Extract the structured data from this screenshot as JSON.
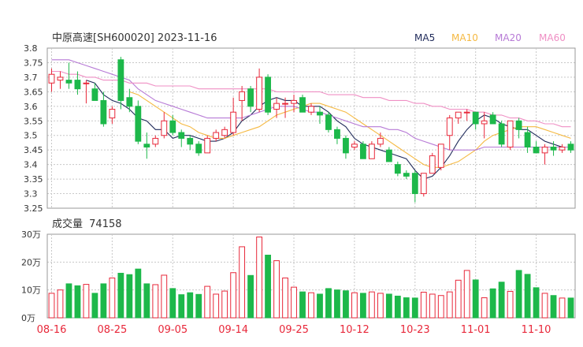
{
  "header": {
    "title": "中原高速[SH600020] 2023-11-16",
    "ma_labels": [
      {
        "label": "MA5",
        "color": "#1f2a5a"
      },
      {
        "label": "MA10",
        "color": "#f5b942"
      },
      {
        "label": "MA20",
        "color": "#b77ad6"
      },
      {
        "label": "MA60",
        "color": "#ef8fc4"
      }
    ]
  },
  "volume_header": {
    "label": "成交量",
    "value": "74158"
  },
  "colors": {
    "up": "#e8283a",
    "down": "#1db84a",
    "grid": "#c8c8c8",
    "axis": "#333333",
    "date": "#e8283a"
  },
  "chart_data": [
    {
      "type": "candlestick",
      "title": "中原高速[SH600020] 2023-11-16",
      "y_ticks": [
        "3.8",
        "3.75",
        "3.7",
        "3.65",
        "3.6",
        "3.55",
        "3.5",
        "3.45",
        "3.4",
        "3.35",
        "3.3",
        "3.25"
      ],
      "ylim": [
        3.25,
        3.8
      ],
      "dates": [
        "08-16",
        "08-17",
        "08-18",
        "08-21",
        "08-22",
        "08-23",
        "08-24",
        "08-25",
        "08-28",
        "08-29",
        "08-30",
        "08-31",
        "09-01",
        "09-04",
        "09-05",
        "09-06",
        "09-07",
        "09-08",
        "09-11",
        "09-12",
        "09-13",
        "09-14",
        "09-15",
        "09-18",
        "09-19",
        "09-20",
        "09-21",
        "09-22",
        "09-25",
        "09-26",
        "09-27",
        "09-28",
        "10-09",
        "10-10",
        "10-11",
        "10-12",
        "10-13",
        "10-16",
        "10-17",
        "10-18",
        "10-19",
        "10-20",
        "10-23",
        "10-24",
        "10-25",
        "10-26",
        "10-27",
        "10-30",
        "10-31",
        "11-01",
        "11-02",
        "11-03",
        "11-06",
        "11-07",
        "11-08",
        "11-09",
        "11-10",
        "11-13",
        "11-14",
        "11-15",
        "11-16"
      ],
      "x_tick_labels": [
        "08-16",
        "08-25",
        "09-05",
        "09-14",
        "09-25",
        "10-12",
        "10-23",
        "11-01",
        "11-10"
      ],
      "x_tick_index": [
        0,
        7,
        14,
        21,
        28,
        35,
        42,
        49,
        56
      ],
      "ohlc": [
        [
          3.68,
          3.73,
          3.65,
          3.71
        ],
        [
          3.69,
          3.72,
          3.66,
          3.7
        ],
        [
          3.69,
          3.75,
          3.66,
          3.68
        ],
        [
          3.69,
          3.72,
          3.64,
          3.66
        ],
        [
          3.68,
          3.69,
          3.61,
          3.68
        ],
        [
          3.66,
          3.68,
          3.62,
          3.62
        ],
        [
          3.62,
          3.65,
          3.53,
          3.54
        ],
        [
          3.56,
          3.6,
          3.54,
          3.59
        ],
        [
          3.76,
          3.77,
          3.59,
          3.62
        ],
        [
          3.63,
          3.66,
          3.58,
          3.6
        ],
        [
          3.6,
          3.62,
          3.47,
          3.48
        ],
        [
          3.47,
          3.51,
          3.42,
          3.46
        ],
        [
          3.47,
          3.5,
          3.46,
          3.49
        ],
        [
          3.5,
          3.58,
          3.49,
          3.55
        ],
        [
          3.55,
          3.57,
          3.5,
          3.51
        ],
        [
          3.51,
          3.52,
          3.46,
          3.49
        ],
        [
          3.49,
          3.5,
          3.45,
          3.47
        ],
        [
          3.47,
          3.48,
          3.43,
          3.44
        ],
        [
          3.44,
          3.5,
          3.44,
          3.49
        ],
        [
          3.49,
          3.52,
          3.48,
          3.51
        ],
        [
          3.5,
          3.53,
          3.49,
          3.52
        ],
        [
          3.51,
          3.63,
          3.5,
          3.58
        ],
        [
          3.62,
          3.67,
          3.55,
          3.65
        ],
        [
          3.66,
          3.67,
          3.58,
          3.6
        ],
        [
          3.59,
          3.73,
          3.58,
          3.7
        ],
        [
          3.7,
          3.71,
          3.57,
          3.58
        ],
        [
          3.59,
          3.63,
          3.56,
          3.61
        ],
        [
          3.61,
          3.63,
          3.56,
          3.61
        ],
        [
          3.61,
          3.64,
          3.58,
          3.62
        ],
        [
          3.63,
          3.64,
          3.58,
          3.58
        ],
        [
          3.58,
          3.61,
          3.57,
          3.6
        ],
        [
          3.58,
          3.6,
          3.54,
          3.57
        ],
        [
          3.57,
          3.58,
          3.51,
          3.52
        ],
        [
          3.52,
          3.53,
          3.47,
          3.49
        ],
        [
          3.49,
          3.5,
          3.42,
          3.44
        ],
        [
          3.46,
          3.48,
          3.45,
          3.47
        ],
        [
          3.47,
          3.48,
          3.42,
          3.42
        ],
        [
          3.42,
          3.48,
          3.42,
          3.47
        ],
        [
          3.47,
          3.51,
          3.46,
          3.49
        ],
        [
          3.45,
          3.46,
          3.41,
          3.41
        ],
        [
          3.4,
          3.41,
          3.36,
          3.37
        ],
        [
          3.37,
          3.38,
          3.35,
          3.36
        ],
        [
          3.37,
          3.38,
          3.27,
          3.3
        ],
        [
          3.3,
          3.37,
          3.29,
          3.37
        ],
        [
          3.37,
          3.44,
          3.37,
          3.43
        ],
        [
          3.39,
          3.47,
          3.38,
          3.47
        ],
        [
          3.5,
          3.57,
          3.45,
          3.56
        ],
        [
          3.56,
          3.58,
          3.54,
          3.58
        ],
        [
          3.58,
          3.59,
          3.55,
          3.58
        ],
        [
          3.58,
          3.58,
          3.52,
          3.54
        ],
        [
          3.54,
          3.58,
          3.49,
          3.55
        ],
        [
          3.57,
          3.58,
          3.54,
          3.54
        ],
        [
          3.54,
          3.55,
          3.46,
          3.47
        ],
        [
          3.46,
          3.55,
          3.45,
          3.55
        ],
        [
          3.55,
          3.56,
          3.49,
          3.52
        ],
        [
          3.51,
          3.53,
          3.44,
          3.46
        ],
        [
          3.46,
          3.48,
          3.44,
          3.44
        ],
        [
          3.44,
          3.47,
          3.4,
          3.46
        ],
        [
          3.46,
          3.48,
          3.43,
          3.45
        ],
        [
          3.45,
          3.47,
          3.44,
          3.46
        ],
        [
          3.47,
          3.48,
          3.44,
          3.45
        ]
      ],
      "ma_series": [
        {
          "name": "MA5",
          "values": [
            null,
            null,
            null,
            null,
            3.69,
            3.68,
            3.64,
            3.62,
            3.61,
            3.59,
            3.56,
            3.55,
            3.52,
            3.52,
            3.49,
            3.5,
            3.5,
            3.49,
            3.48,
            3.48,
            3.49,
            3.51,
            3.55,
            3.57,
            3.6,
            3.62,
            3.63,
            3.62,
            3.62,
            3.6,
            3.6,
            3.6,
            3.58,
            3.55,
            3.53,
            3.49,
            3.47,
            3.46,
            3.45,
            3.44,
            3.43,
            3.42,
            3.38,
            3.35,
            3.36,
            3.39,
            3.43,
            3.48,
            3.52,
            3.55,
            3.57,
            3.56,
            3.54,
            3.53,
            3.52,
            3.52,
            3.5,
            3.48,
            3.47,
            3.46,
            3.46
          ]
        },
        {
          "name": "MA10",
          "values": [
            null,
            null,
            null,
            null,
            null,
            null,
            null,
            null,
            null,
            3.65,
            3.64,
            3.62,
            3.6,
            3.58,
            3.56,
            3.54,
            3.53,
            3.51,
            3.5,
            3.49,
            3.49,
            3.5,
            3.51,
            3.52,
            3.53,
            3.55,
            3.57,
            3.58,
            3.59,
            3.6,
            3.61,
            3.61,
            3.6,
            3.59,
            3.58,
            3.56,
            3.54,
            3.52,
            3.5,
            3.48,
            3.46,
            3.44,
            3.42,
            3.4,
            3.39,
            3.39,
            3.4,
            3.41,
            3.43,
            3.45,
            3.48,
            3.5,
            3.51,
            3.52,
            3.53,
            3.53,
            3.53,
            3.52,
            3.51,
            3.5,
            3.49
          ]
        },
        {
          "name": "MA20",
          "values": [
            3.76,
            3.76,
            3.76,
            3.75,
            3.74,
            3.73,
            3.72,
            3.71,
            3.7,
            3.69,
            3.66,
            3.64,
            3.62,
            3.61,
            3.6,
            3.59,
            3.58,
            3.57,
            3.56,
            3.56,
            3.56,
            3.56,
            3.56,
            3.57,
            3.58,
            3.59,
            3.6,
            3.6,
            3.6,
            3.59,
            3.58,
            3.58,
            3.57,
            3.56,
            3.55,
            3.54,
            3.53,
            3.53,
            3.53,
            3.52,
            3.52,
            3.51,
            3.49,
            3.48,
            3.47,
            3.46,
            3.45,
            3.45,
            3.45,
            3.45,
            3.46,
            3.46,
            3.46,
            3.46,
            3.46,
            3.46,
            3.46,
            3.46,
            3.46,
            3.46,
            3.46
          ]
        },
        {
          "name": "MA60",
          "values": [
            3.72,
            3.72,
            3.71,
            3.71,
            3.7,
            3.7,
            3.69,
            3.69,
            3.69,
            3.68,
            3.68,
            3.68,
            3.67,
            3.67,
            3.67,
            3.67,
            3.67,
            3.66,
            3.66,
            3.66,
            3.66,
            3.66,
            3.66,
            3.66,
            3.66,
            3.66,
            3.65,
            3.65,
            3.65,
            3.65,
            3.65,
            3.65,
            3.64,
            3.64,
            3.64,
            3.64,
            3.63,
            3.63,
            3.63,
            3.62,
            3.62,
            3.62,
            3.61,
            3.61,
            3.6,
            3.6,
            3.59,
            3.59,
            3.59,
            3.58,
            3.58,
            3.57,
            3.57,
            3.56,
            3.56,
            3.55,
            3.55,
            3.54,
            3.54,
            3.53,
            3.53
          ]
        }
      ]
    },
    {
      "type": "bar",
      "title": "成交量",
      "y_ticks": [
        "30万",
        "20万",
        "10万",
        "0万"
      ],
      "ylim": [
        0,
        30
      ],
      "unit": "万",
      "values": [
        8.8,
        10,
        12.2,
        11.5,
        12,
        8.8,
        12.2,
        14.3,
        16,
        15.5,
        17.5,
        12.2,
        11.9,
        15.3,
        10.5,
        8.3,
        9.0,
        8.4,
        11.3,
        8.5,
        9.6,
        16.2,
        25.5,
        15.2,
        29.0,
        22.5,
        20.5,
        14.3,
        11,
        9.3,
        9.0,
        8.5,
        10.5,
        10,
        9.7,
        9,
        8.8,
        9.3,
        8.8,
        8.5,
        7.8,
        7.2,
        7.1,
        9.2,
        8.5,
        8.0,
        9.3,
        13.5,
        17.0,
        13.6,
        7.2,
        10.4,
        12.8,
        9.5,
        17.0,
        15.6,
        10.8,
        8.8,
        8.0,
        7.1,
        7.1,
        7.4
      ]
    }
  ]
}
